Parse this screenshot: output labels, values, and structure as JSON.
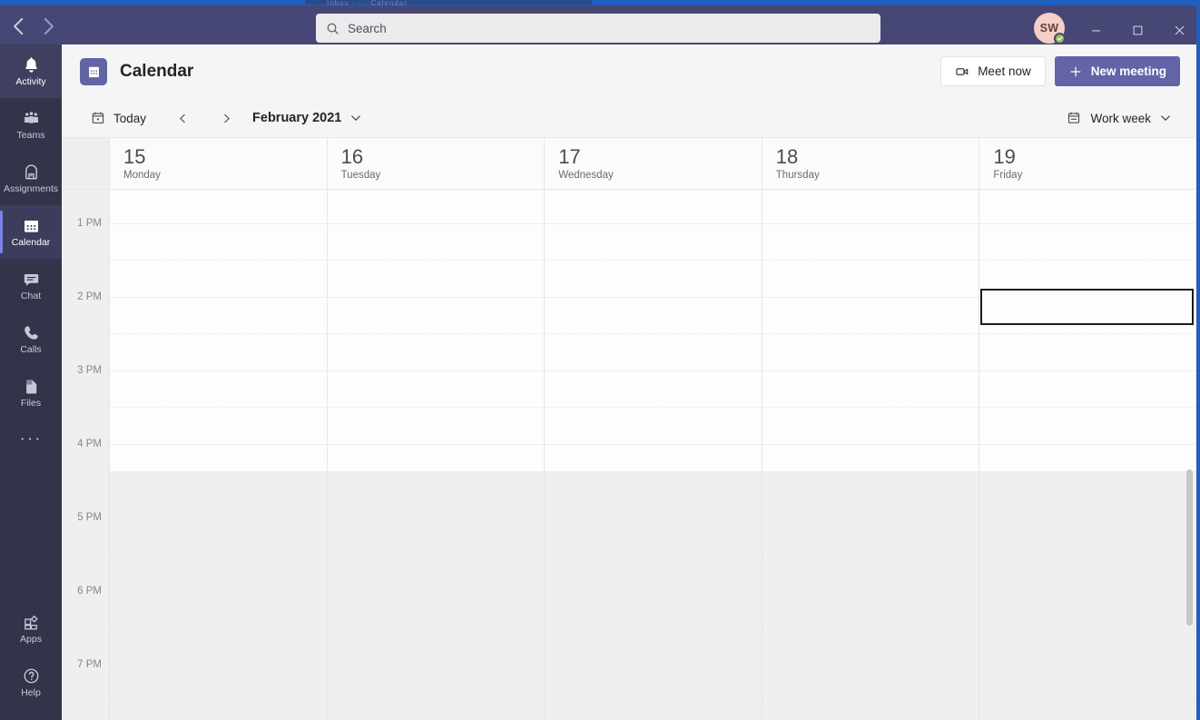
{
  "window": {
    "background_app_hint": "Inbox · · ·  Calendar",
    "titlebar": {
      "back_icon": "chevron-left-icon",
      "forward_icon": "chevron-right-icon"
    },
    "search": {
      "placeholder": "Search",
      "icon": "search-icon"
    },
    "avatar": {
      "initials": "SW",
      "presence": "available",
      "presence_icon": "checkmark-icon"
    },
    "controls": {
      "minimize": "minimize-icon",
      "maximize": "maximize-icon",
      "close": "close-icon"
    },
    "accent_color": "#464775",
    "border_color": "#1f5fbf"
  },
  "rail": {
    "items": [
      {
        "label": "Activity",
        "icon": "bell-icon",
        "state": "hover"
      },
      {
        "label": "Teams",
        "icon": "teams-icon",
        "state": "normal"
      },
      {
        "label": "Assignments",
        "icon": "backpack-icon",
        "state": "normal"
      },
      {
        "label": "Calendar",
        "icon": "calendar-icon",
        "state": "active"
      },
      {
        "label": "Chat",
        "icon": "chat-icon",
        "state": "normal"
      },
      {
        "label": "Calls",
        "icon": "phone-icon",
        "state": "normal"
      },
      {
        "label": "Files",
        "icon": "file-icon",
        "state": "normal"
      }
    ],
    "more_icon": "ellipsis-icon",
    "more_label": "···",
    "bottom_items": [
      {
        "label": "Apps",
        "icon": "apps-icon"
      },
      {
        "label": "Help",
        "icon": "help-icon"
      }
    ],
    "background_color": "#33344a",
    "active_indicator_color": "#7b83eb"
  },
  "header": {
    "app_icon": "calendar-icon",
    "title": "Calendar",
    "meet_now": {
      "label": "Meet now",
      "icon": "video-camera-icon"
    },
    "new_meeting": {
      "label": "New meeting",
      "icon": "plus-icon"
    }
  },
  "toolbar": {
    "today": {
      "label": "Today",
      "icon": "calendar-today-icon"
    },
    "prev_icon": "chevron-left-icon",
    "next_icon": "chevron-right-icon",
    "month_label": "February 2021",
    "month_chevron": "chevron-down-icon",
    "view": {
      "label": "Work week",
      "icon": "calendar-week-icon",
      "chevron": "chevron-down-icon"
    }
  },
  "calendar": {
    "days": [
      {
        "num": "15",
        "name": "Monday"
      },
      {
        "num": "16",
        "name": "Tuesday"
      },
      {
        "num": "17",
        "name": "Wednesday"
      },
      {
        "num": "18",
        "name": "Thursday"
      },
      {
        "num": "19",
        "name": "Friday"
      }
    ],
    "time_labels": [
      "1 PM",
      "2 PM",
      "3 PM",
      "4 PM",
      "5 PM",
      "6 PM",
      "7 PM"
    ],
    "events": [],
    "selected_slot": {
      "day": "Friday",
      "day_index": 4,
      "start": "2 PM",
      "duration_minutes": 30
    },
    "after_hours_start": "4:30 PM",
    "grid_line_color": "#ededed",
    "after_hours_color": "#f0efef"
  }
}
